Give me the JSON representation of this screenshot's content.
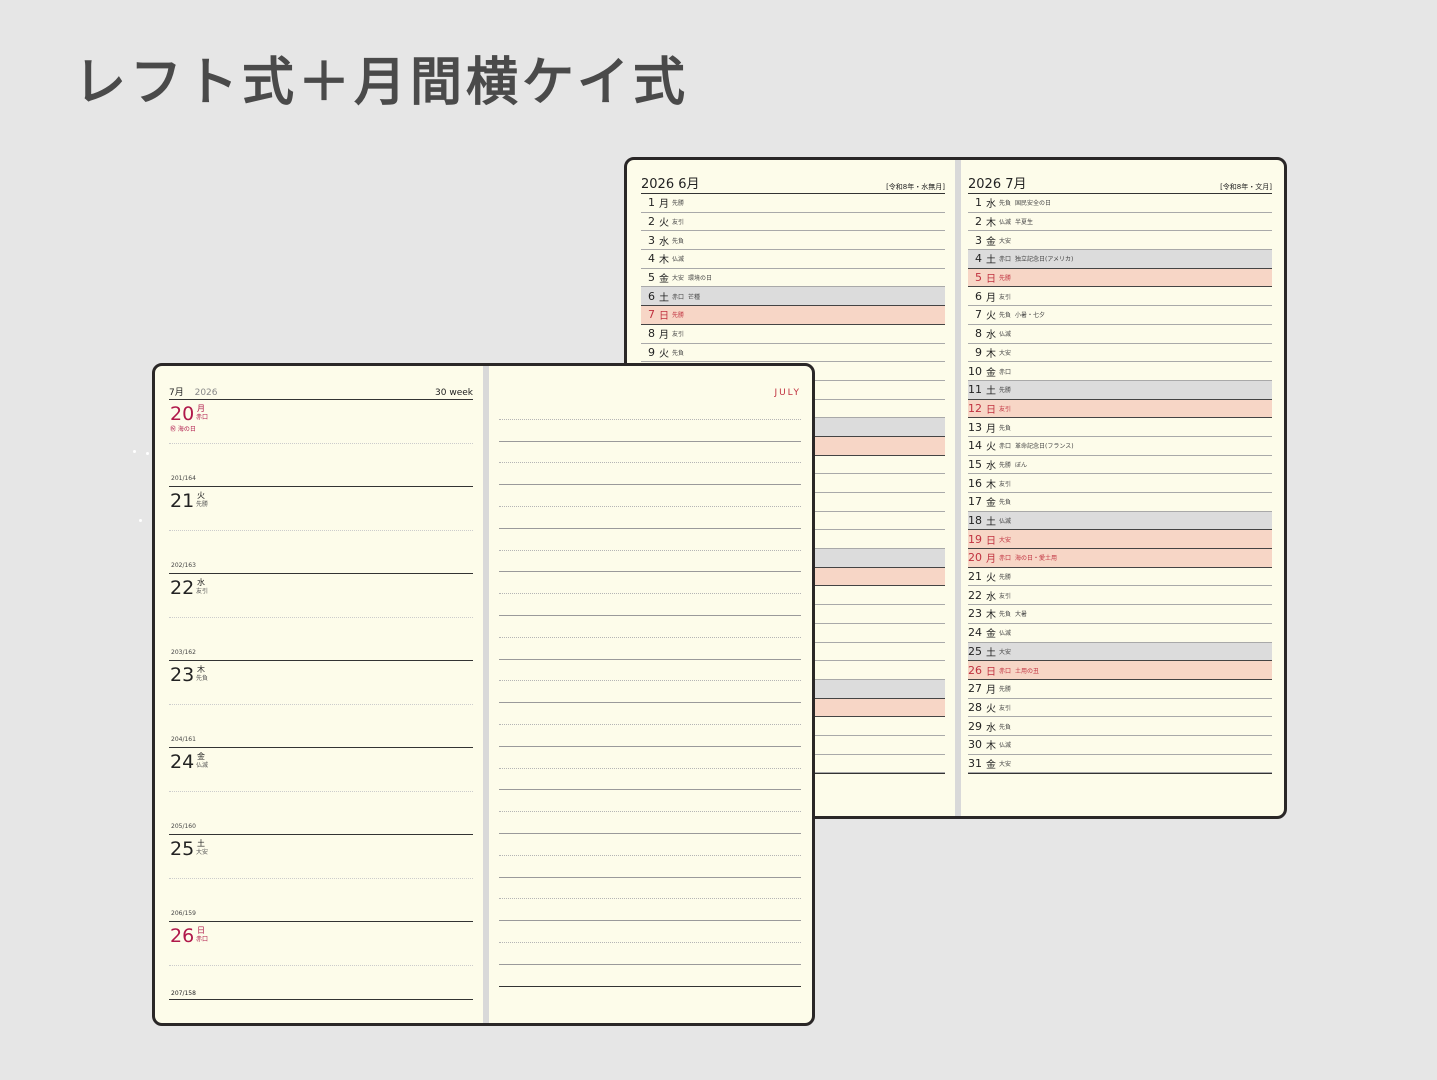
{
  "title": "レフト式＋月間横ケイ式",
  "monthly": {
    "left": {
      "header": "2026 6月",
      "era": "[令和8年・水無月]",
      "rows": [
        {
          "d": "1",
          "dw": "月",
          "rk": "先勝",
          "ev": "",
          "t": ""
        },
        {
          "d": "2",
          "dw": "火",
          "rk": "友引",
          "ev": "",
          "t": ""
        },
        {
          "d": "3",
          "dw": "水",
          "rk": "先負",
          "ev": "",
          "t": ""
        },
        {
          "d": "4",
          "dw": "木",
          "rk": "仏滅",
          "ev": "",
          "t": ""
        },
        {
          "d": "5",
          "dw": "金",
          "rk": "大安",
          "ev": "環境の日",
          "t": ""
        },
        {
          "d": "6",
          "dw": "土",
          "rk": "赤口",
          "ev": "芒種",
          "t": "sat"
        },
        {
          "d": "7",
          "dw": "日",
          "rk": "先勝",
          "ev": "",
          "t": "sun"
        },
        {
          "d": "8",
          "dw": "月",
          "rk": "友引",
          "ev": "",
          "t": ""
        },
        {
          "d": "9",
          "dw": "火",
          "rk": "先負",
          "ev": "",
          "t": ""
        },
        {
          "d": "",
          "dw": "",
          "rk": "",
          "ev": "",
          "t": ""
        },
        {
          "d": "",
          "dw": "",
          "rk": "",
          "ev": "",
          "t": ""
        },
        {
          "d": "",
          "dw": "",
          "rk": "",
          "ev": "",
          "t": ""
        },
        {
          "d": "",
          "dw": "",
          "rk": "",
          "ev": "",
          "t": "sat"
        },
        {
          "d": "",
          "dw": "",
          "rk": "",
          "ev": "",
          "t": "sun"
        },
        {
          "d": "",
          "dw": "",
          "rk": "",
          "ev": "",
          "t": ""
        },
        {
          "d": "",
          "dw": "",
          "rk": "",
          "ev": "",
          "t": ""
        },
        {
          "d": "",
          "dw": "",
          "rk": "",
          "ev": "",
          "t": ""
        },
        {
          "d": "",
          "dw": "",
          "rk": "",
          "ev": "",
          "t": ""
        },
        {
          "d": "",
          "dw": "",
          "rk": "",
          "ev": "",
          "t": ""
        },
        {
          "d": "",
          "dw": "",
          "rk": "",
          "ev": "",
          "t": "sat"
        },
        {
          "d": "",
          "dw": "",
          "rk": "",
          "ev": "",
          "t": "sun"
        },
        {
          "d": "",
          "dw": "",
          "rk": "",
          "ev": "",
          "t": ""
        },
        {
          "d": "",
          "dw": "",
          "rk": "",
          "ev": "",
          "t": ""
        },
        {
          "d": "",
          "dw": "",
          "rk": "",
          "ev": "",
          "t": ""
        },
        {
          "d": "",
          "dw": "",
          "rk": "",
          "ev": "",
          "t": ""
        },
        {
          "d": "",
          "dw": "",
          "rk": "",
          "ev": "",
          "t": ""
        },
        {
          "d": "",
          "dw": "",
          "rk": "",
          "ev": "",
          "t": "sat"
        },
        {
          "d": "",
          "dw": "",
          "rk": "",
          "ev": "",
          "t": "sun"
        },
        {
          "d": "",
          "dw": "",
          "rk": "",
          "ev": "",
          "t": ""
        },
        {
          "d": "",
          "dw": "",
          "rk": "",
          "ev": "",
          "t": ""
        },
        {
          "d": "",
          "dw": "",
          "rk": "",
          "ev": "",
          "t": ""
        }
      ]
    },
    "right": {
      "header": "2026 7月",
      "era": "[令和8年・文月]",
      "rows": [
        {
          "d": "1",
          "dw": "水",
          "rk": "先負",
          "ev": "国民安全の日",
          "t": ""
        },
        {
          "d": "2",
          "dw": "木",
          "rk": "仏滅",
          "ev": "半夏生",
          "t": ""
        },
        {
          "d": "3",
          "dw": "金",
          "rk": "大安",
          "ev": "",
          "t": ""
        },
        {
          "d": "4",
          "dw": "土",
          "rk": "赤口",
          "ev": "独立記念日(アメリカ)",
          "t": "sat"
        },
        {
          "d": "5",
          "dw": "日",
          "rk": "先勝",
          "ev": "",
          "t": "sun"
        },
        {
          "d": "6",
          "dw": "月",
          "rk": "友引",
          "ev": "",
          "t": ""
        },
        {
          "d": "7",
          "dw": "火",
          "rk": "先負",
          "ev": "小暑・七夕",
          "t": ""
        },
        {
          "d": "8",
          "dw": "水",
          "rk": "仏滅",
          "ev": "",
          "t": ""
        },
        {
          "d": "9",
          "dw": "木",
          "rk": "大安",
          "ev": "",
          "t": ""
        },
        {
          "d": "10",
          "dw": "金",
          "rk": "赤口",
          "ev": "",
          "t": ""
        },
        {
          "d": "11",
          "dw": "土",
          "rk": "先勝",
          "ev": "",
          "t": "sat"
        },
        {
          "d": "12",
          "dw": "日",
          "rk": "友引",
          "ev": "",
          "t": "sun"
        },
        {
          "d": "13",
          "dw": "月",
          "rk": "先負",
          "ev": "",
          "t": ""
        },
        {
          "d": "14",
          "dw": "火",
          "rk": "赤口",
          "ev": "革命記念日(フランス)",
          "t": ""
        },
        {
          "d": "15",
          "dw": "水",
          "rk": "先勝",
          "ev": "ぼん",
          "t": ""
        },
        {
          "d": "16",
          "dw": "木",
          "rk": "友引",
          "ev": "",
          "t": ""
        },
        {
          "d": "17",
          "dw": "金",
          "rk": "先負",
          "ev": "",
          "t": ""
        },
        {
          "d": "18",
          "dw": "土",
          "rk": "仏滅",
          "ev": "",
          "t": "sat"
        },
        {
          "d": "19",
          "dw": "日",
          "rk": "大安",
          "ev": "",
          "t": "sun"
        },
        {
          "d": "20",
          "dw": "月",
          "rk": "赤口",
          "ev": "海の日・愛土用",
          "t": "sun"
        },
        {
          "d": "21",
          "dw": "火",
          "rk": "先勝",
          "ev": "",
          "t": ""
        },
        {
          "d": "22",
          "dw": "水",
          "rk": "友引",
          "ev": "",
          "t": ""
        },
        {
          "d": "23",
          "dw": "木",
          "rk": "先負",
          "ev": "大暑",
          "t": ""
        },
        {
          "d": "24",
          "dw": "金",
          "rk": "仏滅",
          "ev": "",
          "t": ""
        },
        {
          "d": "25",
          "dw": "土",
          "rk": "大安",
          "ev": "",
          "t": "sat"
        },
        {
          "d": "26",
          "dw": "日",
          "rk": "赤口",
          "ev": "土用の丑",
          "t": "sun"
        },
        {
          "d": "27",
          "dw": "月",
          "rk": "先勝",
          "ev": "",
          "t": ""
        },
        {
          "d": "28",
          "dw": "火",
          "rk": "友引",
          "ev": "",
          "t": ""
        },
        {
          "d": "29",
          "dw": "水",
          "rk": "先負",
          "ev": "",
          "t": ""
        },
        {
          "d": "30",
          "dw": "木",
          "rk": "仏滅",
          "ev": "",
          "t": ""
        },
        {
          "d": "31",
          "dw": "金",
          "rk": "大安",
          "ev": "",
          "t": ""
        }
      ]
    }
  },
  "weekly": {
    "month": "7月",
    "year": "2026",
    "week": "30 week",
    "right_label": "JULY",
    "days": [
      {
        "num": "20",
        "dw": "月",
        "rk": "赤口",
        "ev": "㊗ 海の日",
        "doy": "",
        "red": true
      },
      {
        "num": "21",
        "dw": "火",
        "rk": "先勝",
        "ev": "",
        "doy": "201/164",
        "red": false
      },
      {
        "num": "22",
        "dw": "水",
        "rk": "友引",
        "ev": "",
        "doy": "202/163",
        "red": false
      },
      {
        "num": "23",
        "dw": "木",
        "rk": "先負",
        "ev": "",
        "doy": "203/162",
        "red": false
      },
      {
        "num": "24",
        "dw": "金",
        "rk": "仏滅",
        "ev": "",
        "doy": "204/161",
        "red": false
      },
      {
        "num": "25",
        "dw": "土",
        "rk": "大安",
        "ev": "",
        "doy": "205/160",
        "red": false
      },
      {
        "num": "26",
        "dw": "日",
        "rk": "赤口",
        "ev": "",
        "doy": "206/159",
        "red": true
      }
    ],
    "footer_doy": "207/158"
  }
}
